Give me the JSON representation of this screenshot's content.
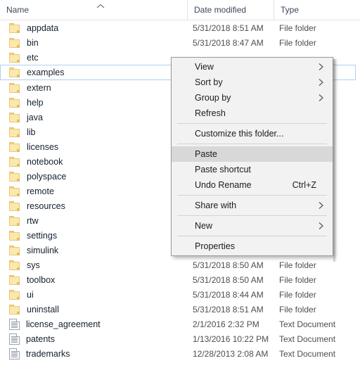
{
  "columns": {
    "name": "Name",
    "date_modified": "Date modified",
    "type": "Type",
    "sort_indicator": "chevron-up-icon"
  },
  "colors": {
    "selection_border": "#a9d2f2",
    "menu_background": "#f2f2f2",
    "menu_highlight": "#d8d8d8",
    "folder_icon": "#fde8ac",
    "header_text": "#3b4758"
  },
  "files": [
    {
      "name": "appdata",
      "icon": "folder-icon",
      "date": "5/31/2018 8:51 AM",
      "type": "File folder",
      "selected": false
    },
    {
      "name": "bin",
      "icon": "folder-icon",
      "date": "5/31/2018 8:47 AM",
      "type": "File folder",
      "selected": false
    },
    {
      "name": "etc",
      "icon": "folder-icon",
      "date": "",
      "type": "",
      "selected": false
    },
    {
      "name": "examples",
      "icon": "folder-icon",
      "date": "",
      "type": "",
      "selected": true
    },
    {
      "name": "extern",
      "icon": "folder-icon",
      "date": "",
      "type": "",
      "selected": false
    },
    {
      "name": "help",
      "icon": "folder-icon",
      "date": "",
      "type": "",
      "selected": false
    },
    {
      "name": "java",
      "icon": "folder-icon",
      "date": "",
      "type": "",
      "selected": false
    },
    {
      "name": "lib",
      "icon": "folder-icon",
      "date": "",
      "type": "",
      "selected": false
    },
    {
      "name": "licenses",
      "icon": "folder-icon",
      "date": "",
      "type": "",
      "selected": false
    },
    {
      "name": "notebook",
      "icon": "folder-icon",
      "date": "",
      "type": "",
      "selected": false
    },
    {
      "name": "polyspace",
      "icon": "folder-icon",
      "date": "",
      "type": "",
      "selected": false
    },
    {
      "name": "remote",
      "icon": "folder-icon",
      "date": "",
      "type": "",
      "selected": false
    },
    {
      "name": "resources",
      "icon": "folder-icon",
      "date": "",
      "type": "",
      "selected": false
    },
    {
      "name": "rtw",
      "icon": "folder-icon",
      "date": "",
      "type": "",
      "selected": false
    },
    {
      "name": "settings",
      "icon": "folder-icon",
      "date": "",
      "type": "",
      "selected": false
    },
    {
      "name": "simulink",
      "icon": "folder-icon",
      "date": "",
      "type": "",
      "selected": false
    },
    {
      "name": "sys",
      "icon": "folder-icon",
      "date": "5/31/2018 8:50 AM",
      "type": "File folder",
      "selected": false
    },
    {
      "name": "toolbox",
      "icon": "folder-icon",
      "date": "5/31/2018 8:50 AM",
      "type": "File folder",
      "selected": false
    },
    {
      "name": "ui",
      "icon": "folder-icon",
      "date": "5/31/2018 8:44 AM",
      "type": "File folder",
      "selected": false
    },
    {
      "name": "uninstall",
      "icon": "folder-icon",
      "date": "5/31/2018 8:51 AM",
      "type": "File folder",
      "selected": false
    },
    {
      "name": "license_agreement",
      "icon": "text-document-icon",
      "date": "2/1/2016 2:32 PM",
      "type": "Text Document",
      "selected": false
    },
    {
      "name": "patents",
      "icon": "text-document-icon",
      "date": "1/13/2016 10:22 PM",
      "type": "Text Document",
      "selected": false
    },
    {
      "name": "trademarks",
      "icon": "text-document-icon",
      "date": "12/28/2013 2:08 AM",
      "type": "Text Document",
      "selected": false
    }
  ],
  "context_menu": {
    "items": [
      {
        "kind": "item",
        "label": "View",
        "accel": "",
        "submenu": true,
        "highlight": false
      },
      {
        "kind": "item",
        "label": "Sort by",
        "accel": "",
        "submenu": true,
        "highlight": false
      },
      {
        "kind": "item",
        "label": "Group by",
        "accel": "",
        "submenu": true,
        "highlight": false
      },
      {
        "kind": "item",
        "label": "Refresh",
        "accel": "",
        "submenu": false,
        "highlight": false
      },
      {
        "kind": "separator"
      },
      {
        "kind": "item",
        "label": "Customize this folder...",
        "accel": "",
        "submenu": false,
        "highlight": false
      },
      {
        "kind": "separator"
      },
      {
        "kind": "item",
        "label": "Paste",
        "accel": "",
        "submenu": false,
        "highlight": true
      },
      {
        "kind": "item",
        "label": "Paste shortcut",
        "accel": "",
        "submenu": false,
        "highlight": false
      },
      {
        "kind": "item",
        "label": "Undo Rename",
        "accel": "Ctrl+Z",
        "submenu": false,
        "highlight": false
      },
      {
        "kind": "separator"
      },
      {
        "kind": "item",
        "label": "Share with",
        "accel": "",
        "submenu": true,
        "highlight": false
      },
      {
        "kind": "separator"
      },
      {
        "kind": "item",
        "label": "New",
        "accel": "",
        "submenu": true,
        "highlight": false
      },
      {
        "kind": "separator"
      },
      {
        "kind": "item",
        "label": "Properties",
        "accel": "",
        "submenu": false,
        "highlight": false
      }
    ]
  }
}
